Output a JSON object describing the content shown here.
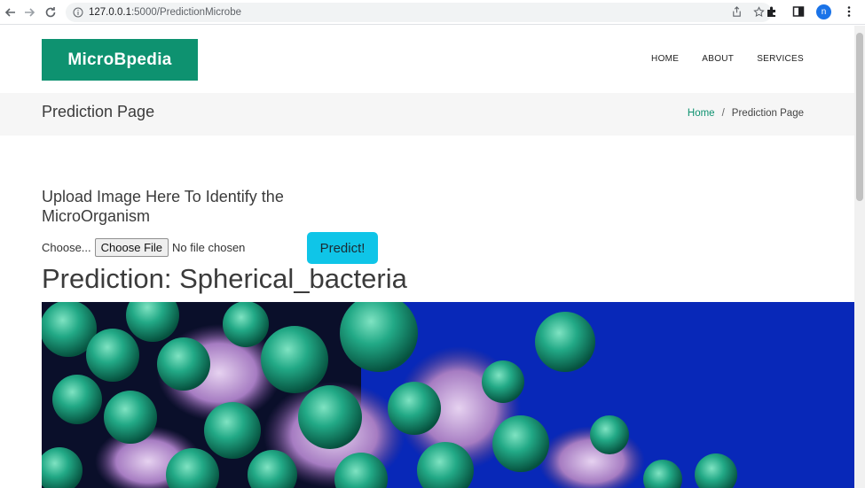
{
  "browser": {
    "url_host": "127.0.0.1",
    "url_path": ":5000/PredictionMicrobe",
    "profile_initial": "n"
  },
  "site": {
    "logo": "MicroBpedia",
    "nav": [
      "HOME",
      "ABOUT",
      "SERVICES"
    ]
  },
  "titlebar": {
    "title": "Prediction Page",
    "breadcrumb_home": "Home",
    "breadcrumb_sep": "/",
    "breadcrumb_current": "Prediction Page"
  },
  "upload": {
    "heading": "Upload Image Here To Identify the MicroOrganism",
    "label": "Choose...",
    "choose_button": "Choose File",
    "file_status": "No file chosen",
    "predict_button": "Predict!"
  },
  "result": {
    "prediction": "Prediction: Spherical_bacteria"
  },
  "colors": {
    "accent": "#0e9270",
    "predict_button": "#0fc5e8",
    "image_background": "#0828b8",
    "cell_green": "#1fa07a"
  }
}
